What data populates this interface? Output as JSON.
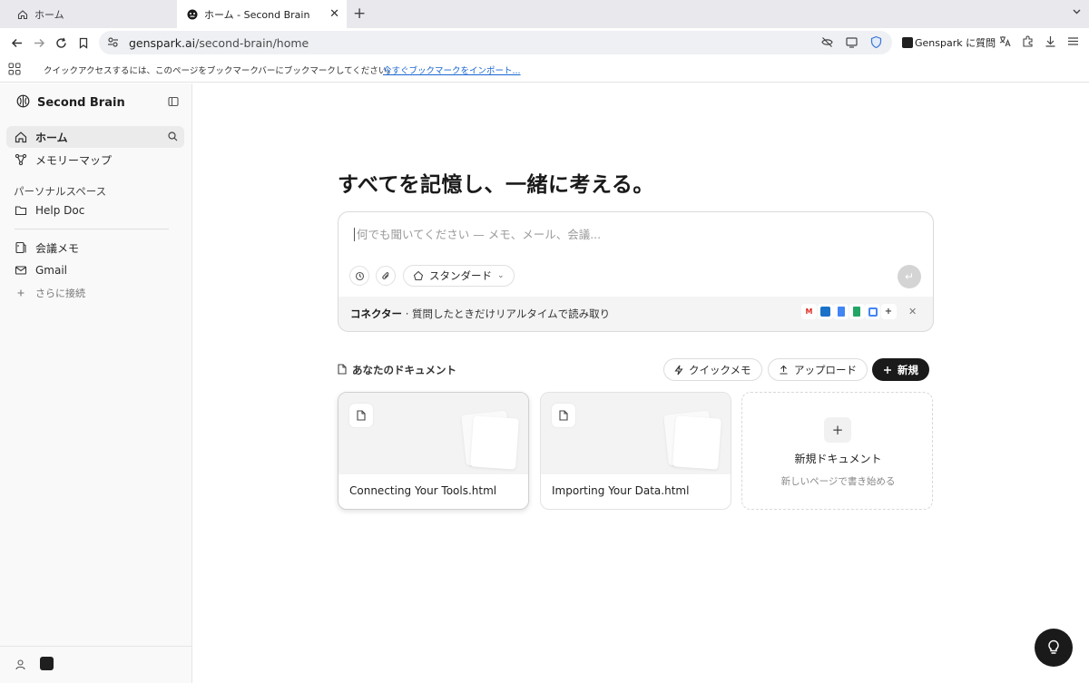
{
  "browser": {
    "tabs": [
      {
        "title": "ホーム",
        "active": false
      },
      {
        "title": "ホーム - Second Brain",
        "active": true
      }
    ],
    "new_tab": "+",
    "url_host": "genspark.ai",
    "url_path": "/second-brain/home",
    "ask_label": "Genspark に質問",
    "bookmark_hint": "クイックアクセスするには、このページをブックマークバーにブックマークしてください。",
    "bookmark_import_link": "今すぐブックマークをインポート..."
  },
  "sidebar": {
    "brand": "Second Brain",
    "items": [
      {
        "label": "ホーム",
        "icon": "home-icon",
        "active": true
      },
      {
        "label": "メモリーマップ",
        "icon": "graph-icon"
      }
    ],
    "section_label": "パーソナルスペース",
    "space_items": [
      {
        "label": "Help Doc",
        "icon": "folder-icon"
      }
    ],
    "connector_items": [
      {
        "label": "会議メモ",
        "icon": "meeting-notes-icon"
      },
      {
        "label": "Gmail",
        "icon": "mail-icon"
      },
      {
        "label": "さらに接続",
        "icon": "plus-icon"
      }
    ]
  },
  "main": {
    "headline": "すべてを記憶し、一緒に考える。",
    "composer": {
      "placeholder": "何でも聞いてください — メモ、メール、会議...",
      "mode_label": "スタンダード"
    },
    "connector": {
      "label": "コネクター",
      "description": " · 質問したときだけリアルタイムで読み取り"
    },
    "documents": {
      "title": "あなたのドキュメント",
      "quick_memo_label": "クイックメモ",
      "upload_label": "アップロード",
      "new_label": "新規",
      "cards": [
        {
          "title": "Connecting Your Tools.html"
        },
        {
          "title": "Importing Your Data.html"
        }
      ],
      "new_doc_title": "新規ドキュメント",
      "new_doc_subtitle": "新しいページで書き始める"
    }
  },
  "colors": {
    "accent_dark": "#1a1a1a",
    "link_blue": "#1a66d2",
    "sidebar_bg": "#f9f9f9"
  }
}
